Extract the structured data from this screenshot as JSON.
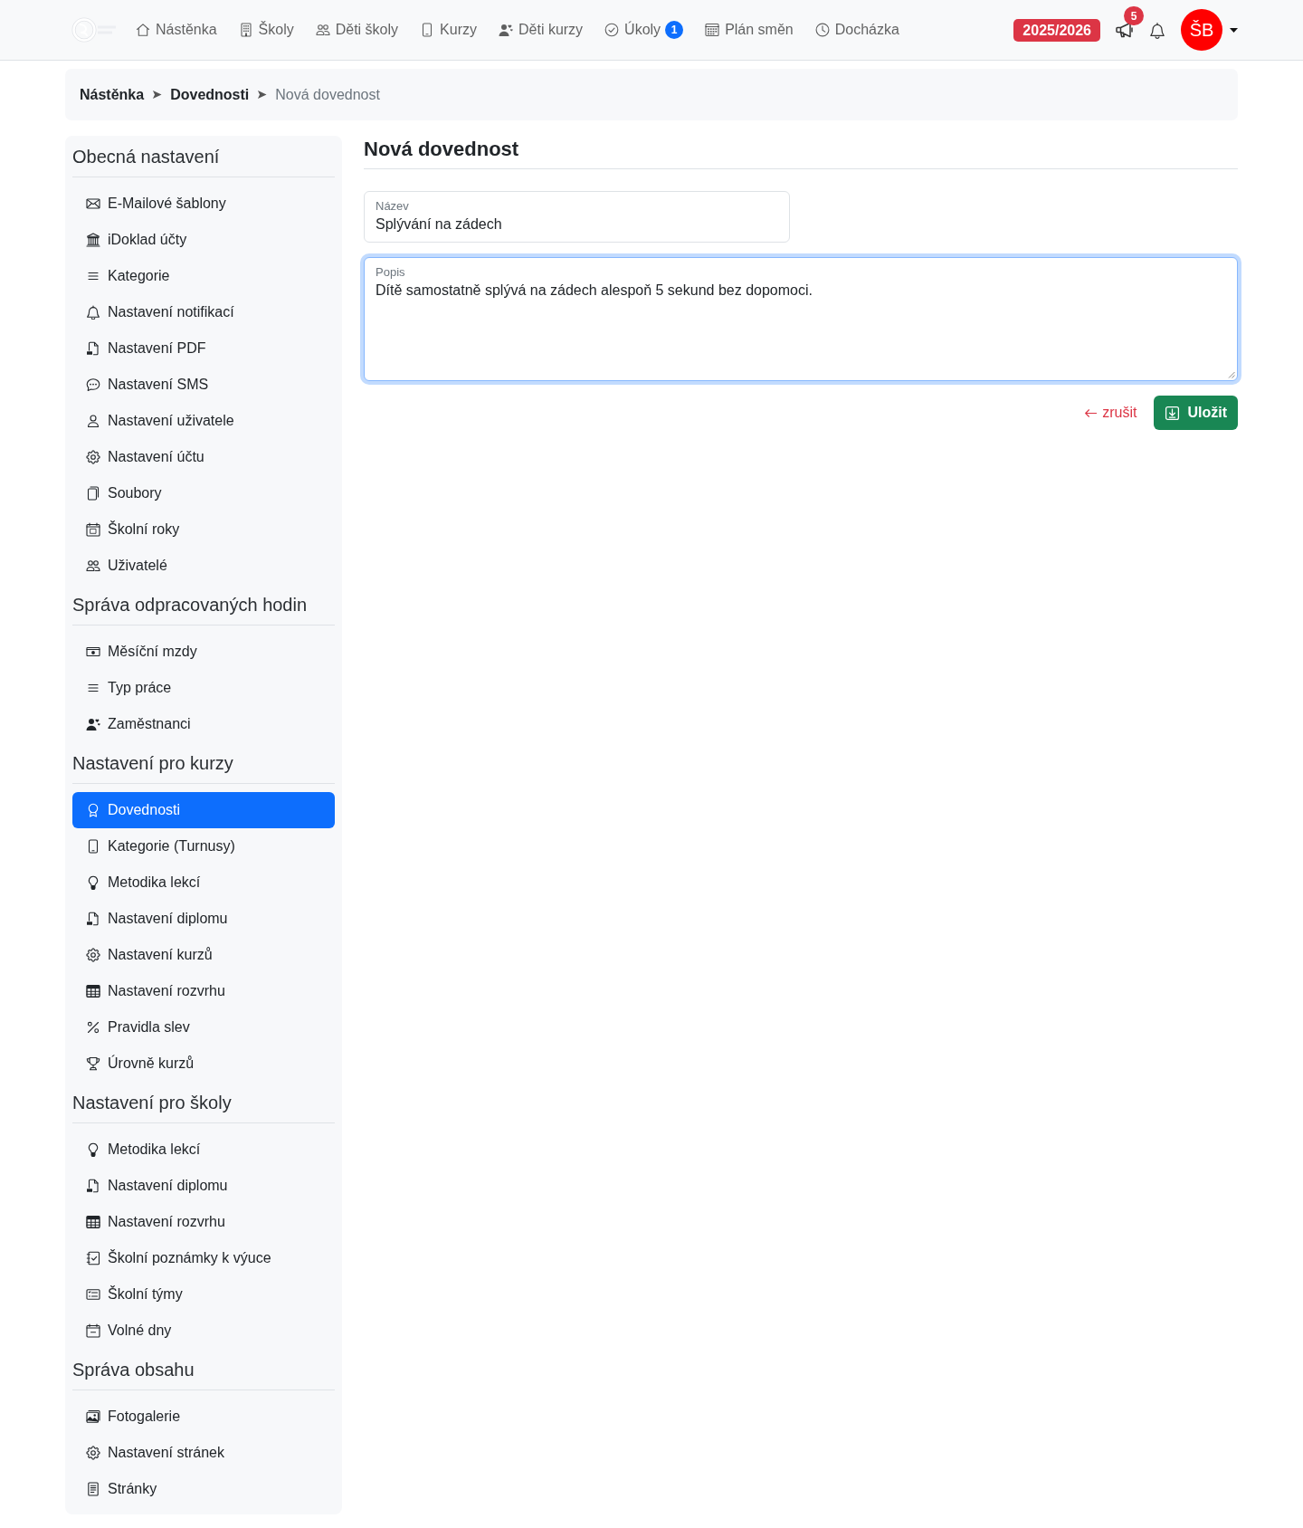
{
  "navbar": {
    "items": [
      {
        "label": "Nástěnka"
      },
      {
        "label": "Školy"
      },
      {
        "label": "Děti školy"
      },
      {
        "label": "Kurzy"
      },
      {
        "label": "Děti kurzy"
      },
      {
        "label": "Úkoly",
        "badge": "1"
      },
      {
        "label": "Plán směn"
      },
      {
        "label": "Docházka"
      }
    ],
    "school_year": "2025/2026",
    "announcements_count": "5",
    "avatar_initials": "ŠB"
  },
  "breadcrumb": [
    {
      "label": "Nástěnka",
      "current": false
    },
    {
      "label": "Dovednosti",
      "current": false
    },
    {
      "label": "Nová dovednost",
      "current": true
    }
  ],
  "sidebar": {
    "sections": [
      {
        "title": "Obecná nastavení",
        "items": [
          {
            "label": "E-Mailové šablony",
            "selected": false
          },
          {
            "label": "iDoklad účty",
            "selected": false
          },
          {
            "label": "Kategorie",
            "selected": false
          },
          {
            "label": "Nastavení notifikací",
            "selected": false
          },
          {
            "label": "Nastavení PDF",
            "selected": false
          },
          {
            "label": "Nastavení SMS",
            "selected": false
          },
          {
            "label": "Nastavení uživatele",
            "selected": false
          },
          {
            "label": "Nastavení účtu",
            "selected": false
          },
          {
            "label": "Soubory",
            "selected": false
          },
          {
            "label": "Školní roky",
            "selected": false
          },
          {
            "label": "Uživatelé",
            "selected": false
          }
        ]
      },
      {
        "title": "Správa odpracovaných hodin",
        "items": [
          {
            "label": "Měsíční mzdy",
            "selected": false
          },
          {
            "label": "Typ práce",
            "selected": false
          },
          {
            "label": "Zaměstnanci",
            "selected": false
          }
        ]
      },
      {
        "title": "Nastavení pro kurzy",
        "items": [
          {
            "label": "Dovednosti",
            "selected": true
          },
          {
            "label": "Kategorie (Turnusy)",
            "selected": false
          },
          {
            "label": "Metodika lekcí",
            "selected": false
          },
          {
            "label": "Nastavení diplomu",
            "selected": false
          },
          {
            "label": "Nastavení kurzů",
            "selected": false
          },
          {
            "label": "Nastavení rozvrhu",
            "selected": false
          },
          {
            "label": "Pravidla slev",
            "selected": false
          },
          {
            "label": "Úrovně kurzů",
            "selected": false
          }
        ]
      },
      {
        "title": "Nastavení pro školy",
        "items": [
          {
            "label": "Metodika lekcí",
            "selected": false
          },
          {
            "label": "Nastavení diplomu",
            "selected": false
          },
          {
            "label": "Nastavení rozvrhu",
            "selected": false
          },
          {
            "label": "Školní poznámky k výuce",
            "selected": false
          },
          {
            "label": "Školní týmy",
            "selected": false
          },
          {
            "label": "Volné dny",
            "selected": false
          }
        ]
      },
      {
        "title": "Správa obsahu",
        "items": [
          {
            "label": "Fotogalerie",
            "selected": false
          },
          {
            "label": "Nastavení stránek",
            "selected": false
          },
          {
            "label": "Stránky",
            "selected": false
          }
        ]
      }
    ]
  },
  "form": {
    "title": "Nová dovednost",
    "fields": [
      {
        "kind": "input",
        "label": "Název",
        "value": "Splývání na zádech",
        "focused": false
      },
      {
        "kind": "textarea",
        "label": "Popis",
        "value": "Dítě samostatně splývá na zádech alespoň 5 sekund bez dopomoci.",
        "focused": true
      }
    ],
    "cancel_label": "zrušit",
    "save_label": "Uložit"
  }
}
